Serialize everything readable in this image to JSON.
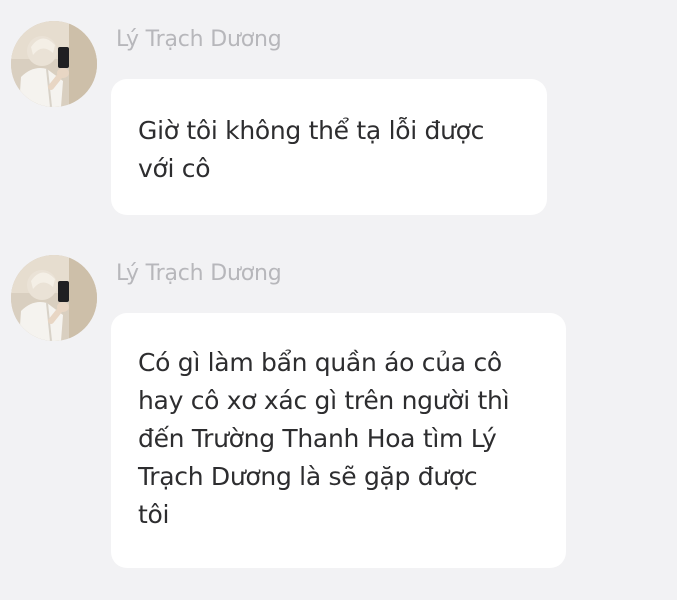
{
  "messages": [
    {
      "sender": "Lý Trạch Dương",
      "avatar_icon": "user-avatar-photo",
      "lines": [
        "Giờ tôi không thể tạ lỗi được",
        "với cô"
      ]
    },
    {
      "sender": "Lý Trạch Dương",
      "avatar_icon": "user-avatar-photo",
      "lines": [
        "Có gì làm bẩn quần áo của cô",
        "hay cô xơ xác gì trên người thì",
        "đến Trường Thanh Hoa tìm Lý",
        "Trạch Dương là sẽ gặp được",
        "tôi"
      ]
    }
  ],
  "colors": {
    "background": "#f2f2f4",
    "bubble": "#ffffff",
    "sender_text": "#b7b7bb",
    "message_text": "#2d2d2f"
  }
}
